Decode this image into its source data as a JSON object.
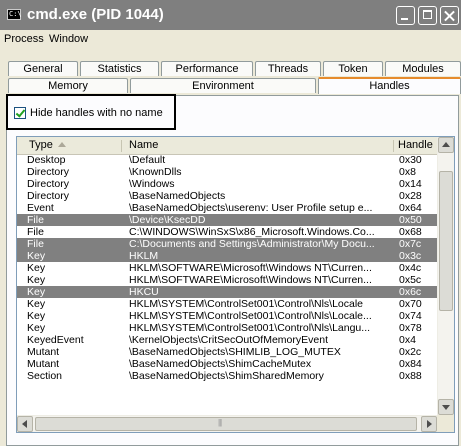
{
  "window": {
    "title": "cmd.exe (PID 1044)",
    "sys_icon_text": "C:\\",
    "colors": {
      "titlebar": "#7f7f7f",
      "selected_row": "#808080",
      "active_tab_accent": "#e68b2c"
    }
  },
  "menu": {
    "items": [
      "Process",
      "Window"
    ]
  },
  "tabs": {
    "row1": [
      "General",
      "Statistics",
      "Performance",
      "Threads",
      "Token",
      "Modules"
    ],
    "row2": [
      "Memory",
      "Environment",
      "Handles"
    ],
    "active": "Handles"
  },
  "options": {
    "hide_unnamed_label": "Hide handles with no name",
    "hide_unnamed_checked": true
  },
  "table": {
    "columns": [
      "Type",
      "Name",
      "Handle"
    ],
    "sort_column": "Type",
    "rows": [
      {
        "type": "Desktop",
        "name": "\\Default",
        "handle": "0x30",
        "selected": false
      },
      {
        "type": "Directory",
        "name": "\\KnownDlls",
        "handle": "0x8",
        "selected": false
      },
      {
        "type": "Directory",
        "name": "\\Windows",
        "handle": "0x14",
        "selected": false
      },
      {
        "type": "Directory",
        "name": "\\BaseNamedObjects",
        "handle": "0x28",
        "selected": false
      },
      {
        "type": "Event",
        "name": "\\BaseNamedObjects\\userenv:  User Profile setup e...",
        "handle": "0x64",
        "selected": false
      },
      {
        "type": "File",
        "name": "\\Device\\KsecDD",
        "handle": "0x50",
        "selected": true
      },
      {
        "type": "File",
        "name": "C:\\WINDOWS\\WinSxS\\x86_Microsoft.Windows.Co...",
        "handle": "0x68",
        "selected": false
      },
      {
        "type": "File",
        "name": "C:\\Documents and Settings\\Administrator\\My Docu...",
        "handle": "0x7c",
        "selected": true
      },
      {
        "type": "Key",
        "name": "HKLM",
        "handle": "0x3c",
        "selected": true
      },
      {
        "type": "Key",
        "name": "HKLM\\SOFTWARE\\Microsoft\\Windows NT\\Curren...",
        "handle": "0x4c",
        "selected": false
      },
      {
        "type": "Key",
        "name": "HKLM\\SOFTWARE\\Microsoft\\Windows NT\\Curren...",
        "handle": "0x5c",
        "selected": false
      },
      {
        "type": "Key",
        "name": "HKCU",
        "handle": "0x6c",
        "selected": true
      },
      {
        "type": "Key",
        "name": "HKLM\\SYSTEM\\ControlSet001\\Control\\Nls\\Locale",
        "handle": "0x70",
        "selected": false
      },
      {
        "type": "Key",
        "name": "HKLM\\SYSTEM\\ControlSet001\\Control\\Nls\\Locale...",
        "handle": "0x74",
        "selected": false
      },
      {
        "type": "Key",
        "name": "HKLM\\SYSTEM\\ControlSet001\\Control\\Nls\\Langu...",
        "handle": "0x78",
        "selected": false
      },
      {
        "type": "KeyedEvent",
        "name": "\\KernelObjects\\CritSecOutOfMemoryEvent",
        "handle": "0x4",
        "selected": false
      },
      {
        "type": "Mutant",
        "name": "\\BaseNamedObjects\\SHIMLIB_LOG_MUTEX",
        "handle": "0x2c",
        "selected": false
      },
      {
        "type": "Mutant",
        "name": "\\BaseNamedObjects\\ShimCacheMutex",
        "handle": "0x84",
        "selected": false
      },
      {
        "type": "Section",
        "name": "\\BaseNamedObjects\\ShimSharedMemory",
        "handle": "0x88",
        "selected": false
      }
    ]
  }
}
